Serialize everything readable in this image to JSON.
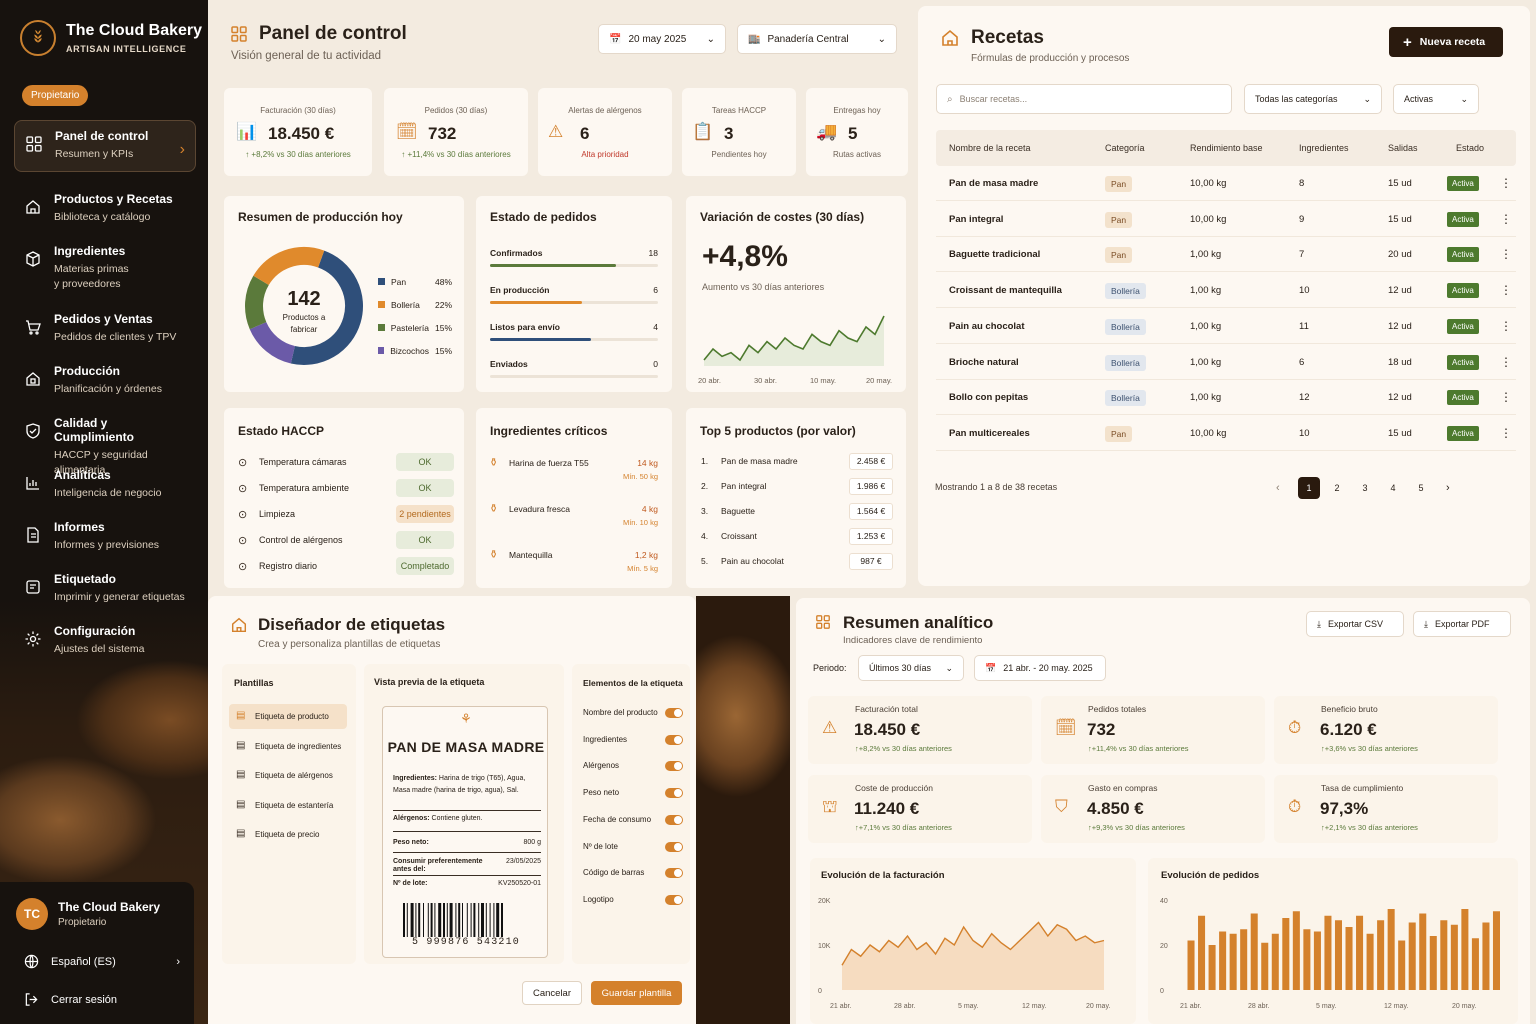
{
  "brand": {
    "name": "The Cloud Bakery",
    "tagline": "ARTISAN INTELLIGENCE",
    "role": "Propietario"
  },
  "nav": [
    {
      "title": "Panel de control",
      "sub": "Resumen y KPIs",
      "icon": "grid-icon"
    },
    {
      "title": "Productos y Recetas",
      "sub": "Biblioteca y catálogo",
      "icon": "box-icon"
    },
    {
      "title": "Ingredientes",
      "sub": "Materias primas y proveedores",
      "icon": "cube-icon"
    },
    {
      "title": "Pedidos y Ventas",
      "sub": "Pedidos de clientes y TPV",
      "icon": "cart-icon"
    },
    {
      "title": "Producción",
      "sub": "Planificación y órdenes",
      "icon": "factory-icon"
    },
    {
      "title": "Calidad y Cumplimiento",
      "sub": "HACCP y seguridad alimentaria",
      "icon": "shield-icon"
    },
    {
      "title": "Analíticas",
      "sub": "Inteligencia de negocio",
      "icon": "bar-chart-icon"
    },
    {
      "title": "Informes",
      "sub": "Informes y previsiones",
      "icon": "document-icon"
    },
    {
      "title": "Etiquetado",
      "sub": "Imprimir y generar etiquetas",
      "icon": "label-icon"
    },
    {
      "title": "Configuración",
      "sub": "Ajustes del sistema",
      "icon": "gear-icon"
    }
  ],
  "user": {
    "initials": "TC",
    "name": "The Cloud Bakery",
    "role": "Propietario",
    "language": "Español (ES)",
    "logout": "Cerrar sesión"
  },
  "dashboard": {
    "title": "Panel de control",
    "subtitle": "Visión general de tu actividad",
    "date": "20 may 2025",
    "store": "Panadería Central",
    "kpis": [
      {
        "label": "Facturación (30 días)",
        "value": "18.450 €",
        "delta": "↑ +8,2% vs 30 días anteriores",
        "icon": "revenue-icon"
      },
      {
        "label": "Pedidos (30 días)",
        "value": "732",
        "delta": "↑ +11,4% vs 30 días anteriores",
        "icon": "calendar-icon"
      },
      {
        "label": "Alertas de alérgenos",
        "value": "6",
        "delta": "Alta prioridad",
        "icon": "warning-icon"
      },
      {
        "label": "Tareas HACCP",
        "value": "3",
        "delta": "Pendientes hoy",
        "icon": "clipboard-icon"
      },
      {
        "label": "Entregas hoy",
        "value": "5",
        "delta": "Rutas activas",
        "icon": "truck-icon"
      }
    ],
    "production": {
      "title": "Resumen de producción hoy",
      "total": "142",
      "total_label": "Productos a fabricar",
      "items": [
        {
          "name": "Pan",
          "pct": "48%",
          "value": 48,
          "color": "#2f4f7a"
        },
        {
          "name": "Bollería",
          "pct": "22%",
          "value": 22,
          "color": "#e08a2c"
        },
        {
          "name": "Pastelería",
          "pct": "15%",
          "value": 15,
          "color": "#5b7a3b"
        },
        {
          "name": "Bizcochos",
          "pct": "15%",
          "value": 15,
          "color": "#6b5aa8"
        }
      ]
    },
    "orders": {
      "title": "Estado de pedidos",
      "rows": [
        {
          "label": "Confirmados",
          "count": "18",
          "fill": 0.75,
          "color": "#5b7a3b"
        },
        {
          "label": "En producción",
          "count": "6",
          "fill": 0.55,
          "color": "#e08a2c"
        },
        {
          "label": "Listos para envío",
          "count": "4",
          "fill": 0.6,
          "color": "#2f4f7a"
        },
        {
          "label": "Enviados",
          "count": "0",
          "fill": 0,
          "color": "#999"
        }
      ]
    },
    "costs": {
      "title": "Variación de costes (30 días)",
      "value": "+4,8%",
      "sub": "Aumento vs 30 días anteriores",
      "x_labels": [
        "20 abr.",
        "30 abr.",
        "10 may.",
        "20 may."
      ],
      "series": [
        2,
        5,
        3,
        4,
        2,
        6,
        4,
        7,
        5,
        8,
        6,
        5,
        9,
        7,
        6,
        10,
        8,
        7,
        11,
        9,
        14
      ]
    },
    "haccp": {
      "title": "Estado HACCP",
      "rows": [
        {
          "label": "Temperatura cámaras",
          "status": "OK",
          "kind": "ok",
          "icon": "thermometer-icon"
        },
        {
          "label": "Temperatura ambiente",
          "status": "OK",
          "kind": "ok",
          "icon": "thermometer-icon"
        },
        {
          "label": "Limpieza",
          "status": "2 pendientes",
          "kind": "warn",
          "icon": "bell-icon"
        },
        {
          "label": "Control de alérgenos",
          "status": "OK",
          "kind": "ok",
          "icon": "allergen-icon"
        },
        {
          "label": "Registro diario",
          "status": "Completado",
          "kind": "ok",
          "icon": "log-icon"
        }
      ]
    },
    "critical": {
      "title": "Ingredientes críticos",
      "rows": [
        {
          "name": "Harina de fuerza T55",
          "qty": "14 kg",
          "min": "Mín. 50 kg"
        },
        {
          "name": "Levadura fresca",
          "qty": "4 kg",
          "min": "Mín. 10 kg"
        },
        {
          "name": "Mantequilla",
          "qty": "1,2 kg",
          "min": "Mín. 5 kg"
        }
      ]
    },
    "top5": {
      "title": "Top 5 productos (por valor)",
      "rows": [
        {
          "n": "1.",
          "name": "Pan de masa madre",
          "value": "2.458 €"
        },
        {
          "n": "2.",
          "name": "Pan integral",
          "value": "1.986 €"
        },
        {
          "n": "3.",
          "name": "Baguette",
          "value": "1.564 €"
        },
        {
          "n": "4.",
          "name": "Croissant",
          "value": "1.253 €"
        },
        {
          "n": "5.",
          "name": "Pain au chocolat",
          "value": "987 €"
        }
      ]
    }
  },
  "recipes": {
    "title": "Recetas",
    "subtitle": "Fórmulas de producción y procesos",
    "new_button": "Nueva receta",
    "search_placeholder": "Buscar recetas...",
    "category_filter": "Todas las categorías",
    "status_filter": "Activas",
    "columns": [
      "Nombre de la receta",
      "Categoría",
      "Rendimiento base",
      "Ingredientes",
      "Salidas",
      "Estado"
    ],
    "rows": [
      {
        "name": "Pan de masa madre",
        "cat": "Pan",
        "yield": "10,00 kg",
        "ing": "8",
        "out": "15 ud",
        "status": "Activa"
      },
      {
        "name": "Pan integral",
        "cat": "Pan",
        "yield": "10,00 kg",
        "ing": "9",
        "out": "15 ud",
        "status": "Activa"
      },
      {
        "name": "Baguette tradicional",
        "cat": "Pan",
        "yield": "1,00 kg",
        "ing": "7",
        "out": "20 ud",
        "status": "Activa"
      },
      {
        "name": "Croissant de mantequilla",
        "cat": "Bollería",
        "yield": "1,00 kg",
        "ing": "10",
        "out": "12 ud",
        "status": "Activa"
      },
      {
        "name": "Pain au chocolat",
        "cat": "Bollería",
        "yield": "1,00 kg",
        "ing": "11",
        "out": "12 ud",
        "status": "Activa"
      },
      {
        "name": "Brioche natural",
        "cat": "Bollería",
        "yield": "1,00 kg",
        "ing": "6",
        "out": "18 ud",
        "status": "Activa"
      },
      {
        "name": "Bollo con pepitas",
        "cat": "Bollería",
        "yield": "1,00 kg",
        "ing": "12",
        "out": "12 ud",
        "status": "Activa"
      },
      {
        "name": "Pan multicereales",
        "cat": "Pan",
        "yield": "10,00 kg",
        "ing": "10",
        "out": "15 ud",
        "status": "Activa"
      }
    ],
    "pagination_text": "Mostrando 1 a 8 de 38 recetas",
    "pages": [
      "1",
      "2",
      "3",
      "4",
      "5"
    ],
    "current_page": "1"
  },
  "labels": {
    "title": "Diseñador de etiquetas",
    "subtitle": "Crea y personaliza plantillas de etiquetas",
    "templates_title": "Plantillas",
    "templates": [
      "Etiqueta de producto",
      "Etiqueta de ingredientes",
      "Etiqueta de alérgenos",
      "Etiqueta de estantería",
      "Etiqueta de precio"
    ],
    "preview_title": "Vista previa de la etiqueta",
    "preview": {
      "product": "PAN DE MASA MADRE",
      "ingredients_label": "Ingredientes:",
      "ingredients": "Harina de trigo (T65), Agua, Masa madre (harina de trigo, agua), Sal.",
      "allergens_label": "Alérgenos:",
      "allergens": "Contiene gluten.",
      "net_label": "Peso neto:",
      "net": "800 g",
      "best_label": "Consumir preferentemente antes del:",
      "best": "23/05/2025",
      "lot_label": "Nº de lote:",
      "lot": "KV250520-01",
      "barcode": "5 999876 543210"
    },
    "elements_title": "Elementos de la etiqueta",
    "elements": [
      "Nombre del producto",
      "Ingredientes",
      "Alérgenos",
      "Peso neto",
      "Fecha de consumo",
      "Nº de lote",
      "Código de barras",
      "Logotipo"
    ],
    "cancel": "Cancelar",
    "save": "Guardar plantilla"
  },
  "analytics": {
    "title": "Resumen analítico",
    "subtitle": "Indicadores clave de rendimiento",
    "export_csv": "Exportar CSV",
    "export_pdf": "Exportar PDF",
    "period_label": "Periodo:",
    "period": "Últimos 30 días",
    "range": "21 abr. - 20 may. 2025",
    "kpis": [
      {
        "label": "Facturación total",
        "value": "18.450 €",
        "delta": "↑+8,2% vs 30 días anteriores",
        "icon": "warning-icon"
      },
      {
        "label": "Pedidos totales",
        "value": "732",
        "delta": "↑+11,4% vs 30 días anteriores",
        "icon": "calendar-icon"
      },
      {
        "label": "Beneficio bruto",
        "value": "6.120 €",
        "delta": "↑+3,6% vs 30 días anteriores",
        "icon": "stopwatch-icon"
      },
      {
        "label": "Coste de producción",
        "value": "11.240 €",
        "delta": "↑+7,1% vs 30 días anteriores",
        "icon": "bank-icon"
      },
      {
        "label": "Gasto en compras",
        "value": "4.850 €",
        "delta": "↑+9,3% vs 30 días anteriores",
        "icon": "shield-icon"
      },
      {
        "label": "Tasa de cumplimiento",
        "value": "97,3%",
        "delta": "↑+2,1% vs 30 días anteriores",
        "icon": "stopwatch-icon"
      }
    ]
  },
  "chart_data": [
    {
      "type": "area",
      "title": "Evolución de la facturación",
      "x_labels": [
        "21 abr.",
        "28 abr.",
        "5 may.",
        "12 may.",
        "20 may."
      ],
      "y_ticks": [
        "20K",
        "10K",
        "0"
      ],
      "ylim": [
        0,
        20000
      ],
      "values": [
        5500,
        9000,
        7500,
        10000,
        8500,
        11000,
        9500,
        12000,
        9000,
        10500,
        8000,
        11500,
        10000,
        14000,
        11000,
        9500,
        12500,
        10500,
        9000,
        11000,
        13000,
        15000,
        12000,
        14500,
        13500,
        11000,
        12000,
        10500,
        11000
      ]
    },
    {
      "type": "bar",
      "title": "Evolución de pedidos",
      "x_labels": [
        "21 abr.",
        "28 abr.",
        "5 may.",
        "12 may.",
        "20 may."
      ],
      "y_ticks": [
        "40",
        "20",
        "0"
      ],
      "ylim": [
        0,
        40
      ],
      "values": [
        22,
        33,
        20,
        26,
        25,
        27,
        34,
        21,
        25,
        32,
        35,
        27,
        26,
        33,
        31,
        28,
        33,
        25,
        31,
        36,
        22,
        30,
        34,
        24,
        31,
        29,
        36,
        23,
        30,
        35
      ]
    }
  ]
}
